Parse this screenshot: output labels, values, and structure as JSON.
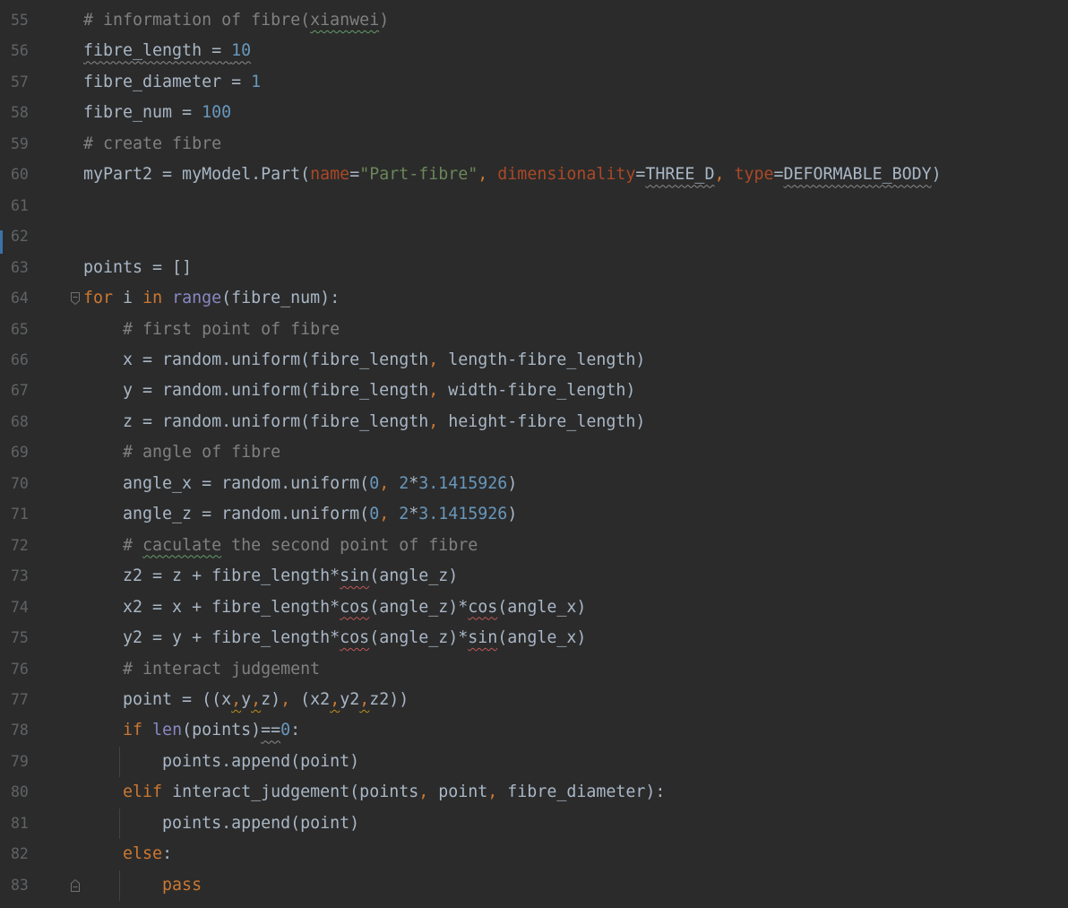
{
  "editor": {
    "colors": {
      "background": "#2b2b2b",
      "line_number": "#606366",
      "plain": "#a9b7c6",
      "comment": "#808080",
      "keyword": "#cc7832",
      "comma": "#cc7832",
      "number": "#6897bb",
      "string": "#6a8759",
      "param": "#aa4926",
      "builtin": "#8888c6",
      "change_marker": "#3b73a7",
      "indent_guide": "#404244",
      "fold_marker": "#707070",
      "squiggle_typo": "#659c6b",
      "squiggle_weak": "#8a8a8a",
      "squiggle_warning": "#bc5a58",
      "squiggle_pep8": "#be9117"
    },
    "lines": [
      {
        "number": "55",
        "tokens": [
          {
            "text": "# information of fibre(",
            "type": "comment"
          },
          {
            "text": "xianwei",
            "type": "comment",
            "squiggle": "typo"
          },
          {
            "text": ")",
            "type": "comment"
          }
        ]
      },
      {
        "number": "56",
        "tokens": [
          {
            "text": "fibre_length = ",
            "type": "plain",
            "squiggle": "weak"
          },
          {
            "text": "10",
            "type": "number",
            "squiggle": "weak"
          }
        ]
      },
      {
        "number": "57",
        "tokens": [
          {
            "text": "fibre_diameter = ",
            "type": "plain"
          },
          {
            "text": "1",
            "type": "number"
          }
        ]
      },
      {
        "number": "58",
        "tokens": [
          {
            "text": "fibre_num = ",
            "type": "plain"
          },
          {
            "text": "100",
            "type": "number"
          }
        ]
      },
      {
        "number": "59",
        "tokens": [
          {
            "text": "# create fibre",
            "type": "comment"
          }
        ]
      },
      {
        "number": "60",
        "tokens": [
          {
            "text": "myPart2 = myModel.Part(",
            "type": "plain"
          },
          {
            "text": "name",
            "type": "param"
          },
          {
            "text": "=",
            "type": "plain"
          },
          {
            "text": "\"Part-fibre\"",
            "type": "string"
          },
          {
            "text": ", ",
            "type": "comma"
          },
          {
            "text": "dimensionality",
            "type": "param"
          },
          {
            "text": "=",
            "type": "plain"
          },
          {
            "text": "THREE_D",
            "type": "plain",
            "squiggle": "weak"
          },
          {
            "text": ", ",
            "type": "comma"
          },
          {
            "text": "type",
            "type": "param"
          },
          {
            "text": "=",
            "type": "plain"
          },
          {
            "text": "DEFORMABLE_BODY",
            "type": "plain",
            "squiggle": "weak"
          },
          {
            "text": ")",
            "type": "plain"
          }
        ]
      },
      {
        "number": "61",
        "tokens": []
      },
      {
        "number": "62",
        "tokens": [],
        "change_marker": true
      },
      {
        "number": "63",
        "tokens": [
          {
            "text": "points = []",
            "type": "plain"
          }
        ]
      },
      {
        "number": "64",
        "fold": "start",
        "tokens": [
          {
            "text": "for",
            "type": "keyword"
          },
          {
            "text": " i ",
            "type": "plain"
          },
          {
            "text": "in",
            "type": "keyword"
          },
          {
            "text": " range",
            "type": "builtin"
          },
          {
            "text": "(fibre_num):",
            "type": "plain"
          }
        ]
      },
      {
        "number": "65",
        "tokens": [
          {
            "text": "    # first point of fibre",
            "type": "comment"
          }
        ]
      },
      {
        "number": "66",
        "tokens": [
          {
            "text": "    x = random.uniform(fibre_length",
            "type": "plain"
          },
          {
            "text": ", ",
            "type": "comma"
          },
          {
            "text": "length-fibre_length)",
            "type": "plain"
          }
        ]
      },
      {
        "number": "67",
        "tokens": [
          {
            "text": "    y = random.uniform(fibre_length",
            "type": "plain"
          },
          {
            "text": ", ",
            "type": "comma"
          },
          {
            "text": "width-fibre_length)",
            "type": "plain"
          }
        ]
      },
      {
        "number": "68",
        "tokens": [
          {
            "text": "    z = random.uniform(fibre_length",
            "type": "plain"
          },
          {
            "text": ", ",
            "type": "comma"
          },
          {
            "text": "height-fibre_length)",
            "type": "plain"
          }
        ]
      },
      {
        "number": "69",
        "tokens": [
          {
            "text": "    # angle of fibre",
            "type": "comment"
          }
        ]
      },
      {
        "number": "70",
        "tokens": [
          {
            "text": "    angle_x = random.uniform(",
            "type": "plain"
          },
          {
            "text": "0",
            "type": "number"
          },
          {
            "text": ", ",
            "type": "comma"
          },
          {
            "text": "2",
            "type": "number"
          },
          {
            "text": "*",
            "type": "plain"
          },
          {
            "text": "3.1415926",
            "type": "number"
          },
          {
            "text": ")",
            "type": "plain"
          }
        ]
      },
      {
        "number": "71",
        "tokens": [
          {
            "text": "    angle_z = random.uniform(",
            "type": "plain"
          },
          {
            "text": "0",
            "type": "number"
          },
          {
            "text": ", ",
            "type": "comma"
          },
          {
            "text": "2",
            "type": "number"
          },
          {
            "text": "*",
            "type": "plain"
          },
          {
            "text": "3.1415926",
            "type": "number"
          },
          {
            "text": ")",
            "type": "plain"
          }
        ]
      },
      {
        "number": "72",
        "tokens": [
          {
            "text": "    # ",
            "type": "comment"
          },
          {
            "text": "caculate",
            "type": "comment",
            "squiggle": "typo"
          },
          {
            "text": " the second point of fibre",
            "type": "comment"
          }
        ]
      },
      {
        "number": "73",
        "tokens": [
          {
            "text": "    z2 = z + fibre_length*",
            "type": "plain"
          },
          {
            "text": "sin",
            "type": "plain",
            "squiggle": "warning"
          },
          {
            "text": "(angle_z)",
            "type": "plain"
          }
        ]
      },
      {
        "number": "74",
        "tokens": [
          {
            "text": "    x2 = x + fibre_length*",
            "type": "plain"
          },
          {
            "text": "cos",
            "type": "plain",
            "squiggle": "warning"
          },
          {
            "text": "(angle_z)*",
            "type": "plain"
          },
          {
            "text": "cos",
            "type": "plain",
            "squiggle": "warning"
          },
          {
            "text": "(angle_x)",
            "type": "plain"
          }
        ]
      },
      {
        "number": "75",
        "tokens": [
          {
            "text": "    y2 = y + fibre_length*",
            "type": "plain"
          },
          {
            "text": "cos",
            "type": "plain",
            "squiggle": "warning"
          },
          {
            "text": "(angle_z)*",
            "type": "plain"
          },
          {
            "text": "sin",
            "type": "plain",
            "squiggle": "warning"
          },
          {
            "text": "(angle_x)",
            "type": "plain"
          }
        ]
      },
      {
        "number": "76",
        "tokens": [
          {
            "text": "    # interact judgement",
            "type": "comment"
          }
        ]
      },
      {
        "number": "77",
        "tokens": [
          {
            "text": "    point = ((x",
            "type": "plain"
          },
          {
            "text": ",",
            "type": "comma",
            "squiggle": "pep8"
          },
          {
            "text": "y",
            "type": "plain"
          },
          {
            "text": ",",
            "type": "comma",
            "squiggle": "pep8"
          },
          {
            "text": "z)",
            "type": "plain"
          },
          {
            "text": ", ",
            "type": "comma"
          },
          {
            "text": "(x2",
            "type": "plain"
          },
          {
            "text": ",",
            "type": "comma",
            "squiggle": "pep8"
          },
          {
            "text": "y2",
            "type": "plain"
          },
          {
            "text": ",",
            "type": "comma",
            "squiggle": "pep8"
          },
          {
            "text": "z2))",
            "type": "plain"
          }
        ]
      },
      {
        "number": "78",
        "tokens": [
          {
            "text": "    if",
            "type": "keyword"
          },
          {
            "text": " len",
            "type": "builtin"
          },
          {
            "text": "(points)",
            "type": "plain"
          },
          {
            "text": "==",
            "type": "plain",
            "squiggle": "weak"
          },
          {
            "text": "0",
            "type": "number"
          },
          {
            "text": ":",
            "type": "plain"
          }
        ]
      },
      {
        "number": "79",
        "indent_guide": true,
        "tokens": [
          {
            "text": "        points.append(point)",
            "type": "plain"
          }
        ]
      },
      {
        "number": "80",
        "tokens": [
          {
            "text": "    elif",
            "type": "keyword"
          },
          {
            "text": " interact_judgement(points",
            "type": "plain"
          },
          {
            "text": ", ",
            "type": "comma"
          },
          {
            "text": "point",
            "type": "plain"
          },
          {
            "text": ", ",
            "type": "comma"
          },
          {
            "text": "fibre_diameter):",
            "type": "plain"
          }
        ]
      },
      {
        "number": "81",
        "indent_guide": true,
        "tokens": [
          {
            "text": "        points.append(point)",
            "type": "plain"
          }
        ]
      },
      {
        "number": "82",
        "tokens": [
          {
            "text": "    else",
            "type": "keyword"
          },
          {
            "text": ":",
            "type": "plain"
          }
        ]
      },
      {
        "number": "83",
        "indent_guide": true,
        "fold": "end",
        "tokens": [
          {
            "text": "        pass",
            "type": "keyword"
          }
        ]
      }
    ]
  }
}
